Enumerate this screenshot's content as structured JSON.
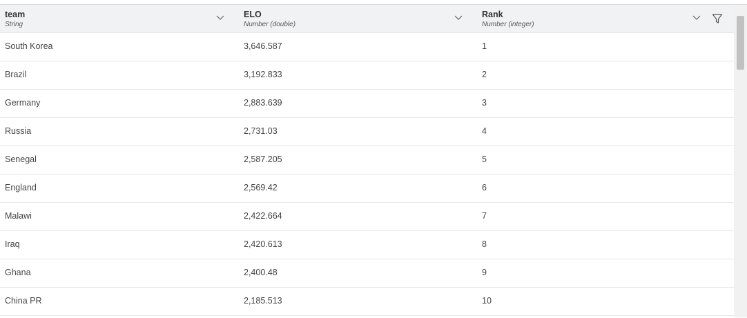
{
  "columns": [
    {
      "name": "team",
      "type": "String"
    },
    {
      "name": "ELO",
      "type": "Number (double)"
    },
    {
      "name": "Rank",
      "type": "Number (integer)"
    }
  ],
  "rows": [
    {
      "team": "South Korea",
      "elo": "3,646.587",
      "rank": "1"
    },
    {
      "team": "Brazil",
      "elo": "3,192.833",
      "rank": "2"
    },
    {
      "team": "Germany",
      "elo": "2,883.639",
      "rank": "3"
    },
    {
      "team": "Russia",
      "elo": "2,731.03",
      "rank": "4"
    },
    {
      "team": "Senegal",
      "elo": "2,587.205",
      "rank": "5"
    },
    {
      "team": "England",
      "elo": "2,569.42",
      "rank": "6"
    },
    {
      "team": "Malawi",
      "elo": "2,422.664",
      "rank": "7"
    },
    {
      "team": "Iraq",
      "elo": "2,420.613",
      "rank": "8"
    },
    {
      "team": "Ghana",
      "elo": "2,400.48",
      "rank": "9"
    },
    {
      "team": "China PR",
      "elo": "2,185.513",
      "rank": "10"
    }
  ],
  "icons": {
    "sort": "chevron-down-icon",
    "filter": "filter-icon"
  },
  "scroll": {
    "position": 0.0
  }
}
